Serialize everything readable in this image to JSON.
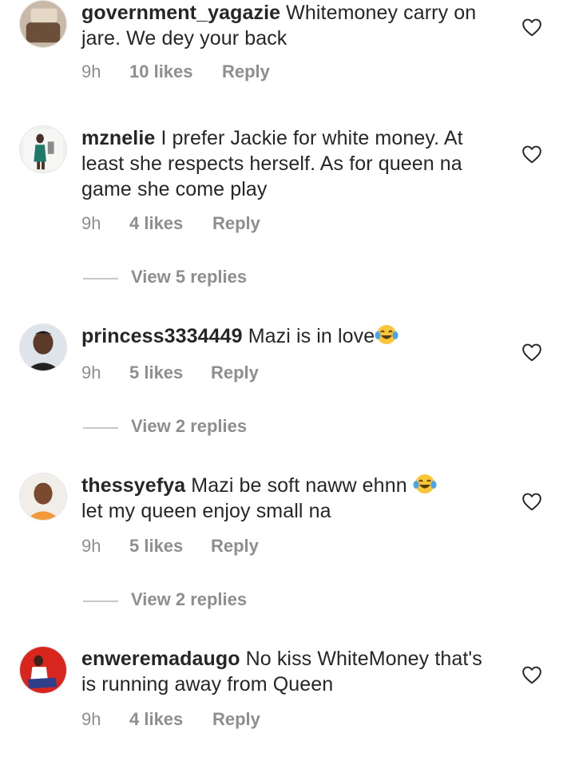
{
  "comments": [
    {
      "username": "government_yagazie",
      "text": "Whitemoney carry on jare. We dey your back",
      "time": "9h",
      "likes": "10 likes",
      "reply": "Reply"
    },
    {
      "username": "mznelie",
      "text": "I prefer Jackie for white money. At least she respects herself. As for queen na game she come play",
      "time": "9h",
      "likes": "4 likes",
      "reply": "Reply",
      "view_replies": "View 5 replies"
    },
    {
      "username": "princess3334449",
      "text": "Mazi is in love",
      "emoji": "tears-of-joy",
      "time": "9h",
      "likes": "5 likes",
      "reply": "Reply",
      "view_replies": "View 2 replies"
    },
    {
      "username": "thessyefya",
      "text": "Mazi be soft naww ehnn",
      "text_after_emoji": "let my queen enjoy small na",
      "emoji": "tears-of-joy",
      "time": "9h",
      "likes": "5 likes",
      "reply": "Reply",
      "view_replies": "View 2 replies"
    },
    {
      "username": "enweremadaugo",
      "text": "No kiss WhiteMoney that's is running away from Queen",
      "time": "9h",
      "likes": "4 likes",
      "reply": "Reply"
    }
  ],
  "icons": {
    "like": "heart-outline-icon",
    "emoji": "face-with-tears-of-joy"
  },
  "colors": {
    "text": "#262626",
    "meta": "#8e8e8e",
    "divider": "#c7c7c7"
  }
}
